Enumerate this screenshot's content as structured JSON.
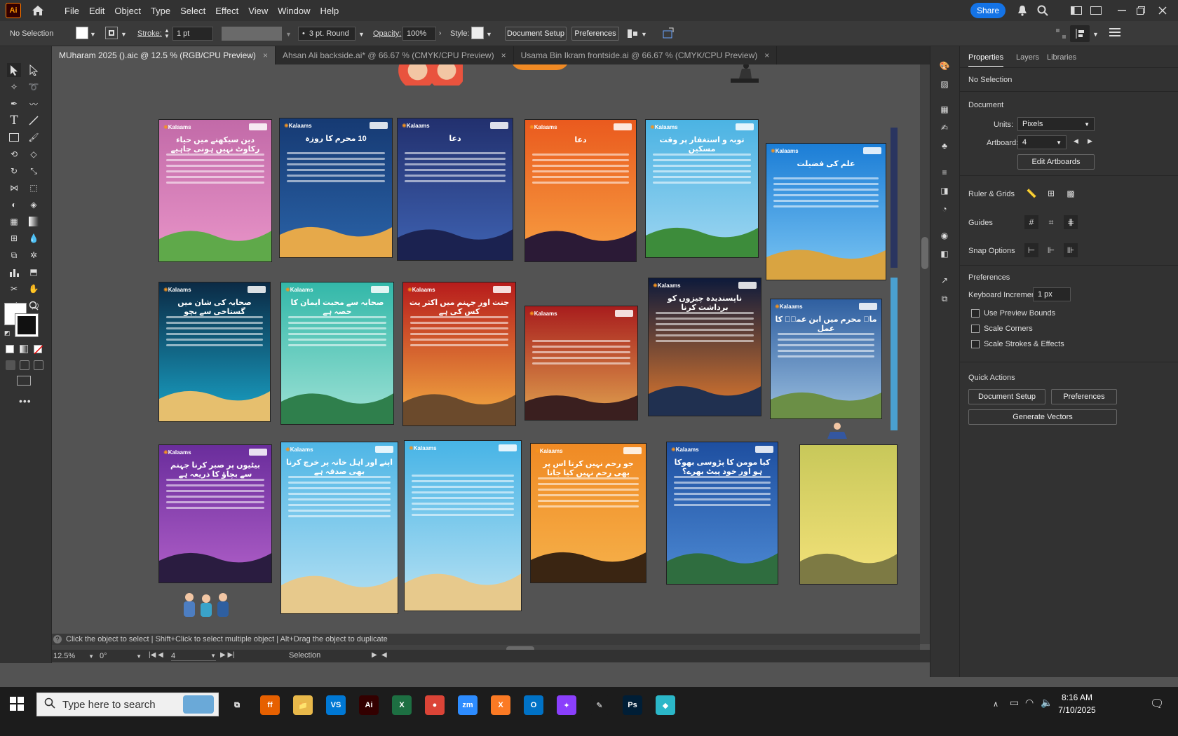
{
  "app": {
    "logo_text": "Ai"
  },
  "menu": [
    "File",
    "Edit",
    "Object",
    "Type",
    "Select",
    "Effect",
    "View",
    "Window",
    "Help"
  ],
  "header": {
    "share_label": "Share"
  },
  "control_bar": {
    "selection": "No Selection",
    "stroke_label": "Stroke:",
    "stroke_value": "1 pt",
    "brush_value": "3 pt. Round",
    "opacity_label": "Opacity:",
    "opacity_value": "100%",
    "style_label": "Style:",
    "document_setup": "Document Setup",
    "preferences": "Preferences"
  },
  "tabs": [
    {
      "label": "MUharam 2025 ().aic @ 12.5 % (RGB/CPU Preview)",
      "active": true
    },
    {
      "label": "Ahsan Ali backside.ai* @ 66.67 % (CMYK/CPU Preview)",
      "active": false
    },
    {
      "label": "Usama Bin Ikram frontside.ai @ 66.67 % (CMYK/CPU Preview)",
      "active": false
    }
  ],
  "tab_close": "×",
  "posters": [
    {
      "title": "دین سیکھنے میں حیاء رکاوٹ نہیں ہونی چاہیے",
      "top": "#c26aa8",
      "bottom": "#e995c9",
      "scene": "#5fa94a"
    },
    {
      "title": "10 محرم کا روزہ",
      "top": "#163a73",
      "bottom": "#2a63a8",
      "scene": "#e6a94a"
    },
    {
      "title": "دعا",
      "top": "#22306e",
      "bottom": "#3f63b3",
      "scene": "#1b2250"
    },
    {
      "title": "دعا",
      "top": "#ea5a1e",
      "bottom": "#f7a042",
      "scene": "#2b1a36"
    },
    {
      "title": "توبہ و استغفار پر وقت مسکین",
      "top": "#4bb3e3",
      "bottom": "#9fd6f1",
      "scene": "#3d8c3b"
    },
    {
      "title": "علم کی فضیلت",
      "top": "#1b7dd6",
      "bottom": "#7cc6f3",
      "scene": "#d9a441"
    },
    {
      "title": "صحابہ کی شان میں گستاخی سے بچو",
      "top": "#0b2a45",
      "bottom": "#19a4c8",
      "scene": "#e6bf6e"
    },
    {
      "title": "صحابہ سے محبت ایمان کا حصہ ہے",
      "top": "#33b8a9",
      "bottom": "#9fe2d6",
      "scene": "#2f7f4c"
    },
    {
      "title": "جنت اور جہنم میں اکثر یت کس کی ہے",
      "top": "#b71c1c",
      "bottom": "#f5b043",
      "scene": "#6b4a2c"
    },
    {
      "title": "",
      "top": "#a81d1d",
      "bottom": "#e0a34f",
      "scene": "#3a1f1f"
    },
    {
      "title": "ناپسندیدہ چیزوں کو برداشت کرنا",
      "top": "#0d1a3b",
      "bottom": "#e27a2e",
      "scene": "#203050"
    },
    {
      "title": "ماہ محرم میں ابن عمرؓ کا عمل",
      "top": "#2f5fa0",
      "bottom": "#9bbfe0",
      "scene": "#6b8f46"
    },
    {
      "title": "بیٹیوں پر صبر کرنا جہنم سے بچاؤ کا ذریعہ ہے",
      "top": "#6a2d9c",
      "bottom": "#b05fc8",
      "scene": "#2a1c40"
    },
    {
      "title": "اپنے اور اہل خانہ پر خرچ کرنا بھی صدقہ ہے",
      "top": "#4fb6e6",
      "bottom": "#b7e1f3",
      "scene": "#e7c98c"
    },
    {
      "title": "",
      "top": "#47b4e6",
      "bottom": "#b9e2f3",
      "scene": "#e7c98c"
    },
    {
      "title": "جو رحم نہیں کرتا اس پر بھی رحم نہیں کیا جاتا",
      "top": "#f08a24",
      "bottom": "#f6b24b",
      "scene": "#3a2512"
    },
    {
      "title": "کیا مومن کا پڑوسی بھوکا ہو اور خود پیٹ بھرے؟",
      "top": "#1e4fa0",
      "bottom": "#4d8ad4",
      "scene": "#2f6d3f"
    },
    {
      "title": "",
      "top": "#c8c85a",
      "bottom": "#f4e27a",
      "scene": "#7d7a44"
    }
  ],
  "brand": {
    "name": "Kalaams"
  },
  "status": {
    "zoom": "12.5%",
    "rotation": "0°",
    "artboard": "4",
    "mode": "Selection",
    "hint": "Click the object to select  |  Shift+Click to select multiple object  |  Alt+Drag the object to duplicate"
  },
  "panel": {
    "tabs": [
      "Properties",
      "Layers",
      "Libraries"
    ],
    "selection": "No Selection",
    "document_heading": "Document",
    "units_label": "Units:",
    "units_value": "Pixels",
    "artboard_label": "Artboard:",
    "artboard_value": "4",
    "edit_artboards": "Edit Artboards",
    "ruler_grids": "Ruler & Grids",
    "guides": "Guides",
    "snap_options": "Snap Options",
    "preferences_heading": "Preferences",
    "keyboard_increment_label": "Keyboard Increment:",
    "keyboard_increment_value": "1 px",
    "use_preview_bounds": "Use Preview Bounds",
    "scale_corners": "Scale Corners",
    "scale_strokes": "Scale Strokes & Effects",
    "quick_actions": "Quick Actions",
    "document_setup": "Document Setup",
    "preferences": "Preferences",
    "generate_vectors": "Generate Vectors"
  },
  "taskbar": {
    "search_placeholder": "Type here to search",
    "time": "8:16 AM",
    "date": "7/10/2025",
    "apps": [
      {
        "name": "task-view",
        "label": "⧉",
        "color": "#1c1c1c"
      },
      {
        "name": "firefox",
        "label": "ff",
        "color": "#e66000"
      },
      {
        "name": "file-explorer",
        "label": "📁",
        "color": "#e8b84a"
      },
      {
        "name": "vscode",
        "label": "VS",
        "color": "#0078d4"
      },
      {
        "name": "illustrator",
        "label": "Ai",
        "color": "#330000"
      },
      {
        "name": "excel",
        "label": "X",
        "color": "#1d6f42"
      },
      {
        "name": "chrome",
        "label": "●",
        "color": "#db4437"
      },
      {
        "name": "zoom",
        "label": "zm",
        "color": "#2d8cff"
      },
      {
        "name": "xampp",
        "label": "X",
        "color": "#fb7a24"
      },
      {
        "name": "outlook",
        "label": "O",
        "color": "#0072c6"
      },
      {
        "name": "copilot",
        "label": "✦",
        "color": "#8a3ffc"
      },
      {
        "name": "pen-app",
        "label": "✎",
        "color": "#1c1c1c"
      },
      {
        "name": "photoshop",
        "label": "Ps",
        "color": "#001e36"
      },
      {
        "name": "other-app",
        "label": "◆",
        "color": "#2bb7c8"
      }
    ]
  }
}
